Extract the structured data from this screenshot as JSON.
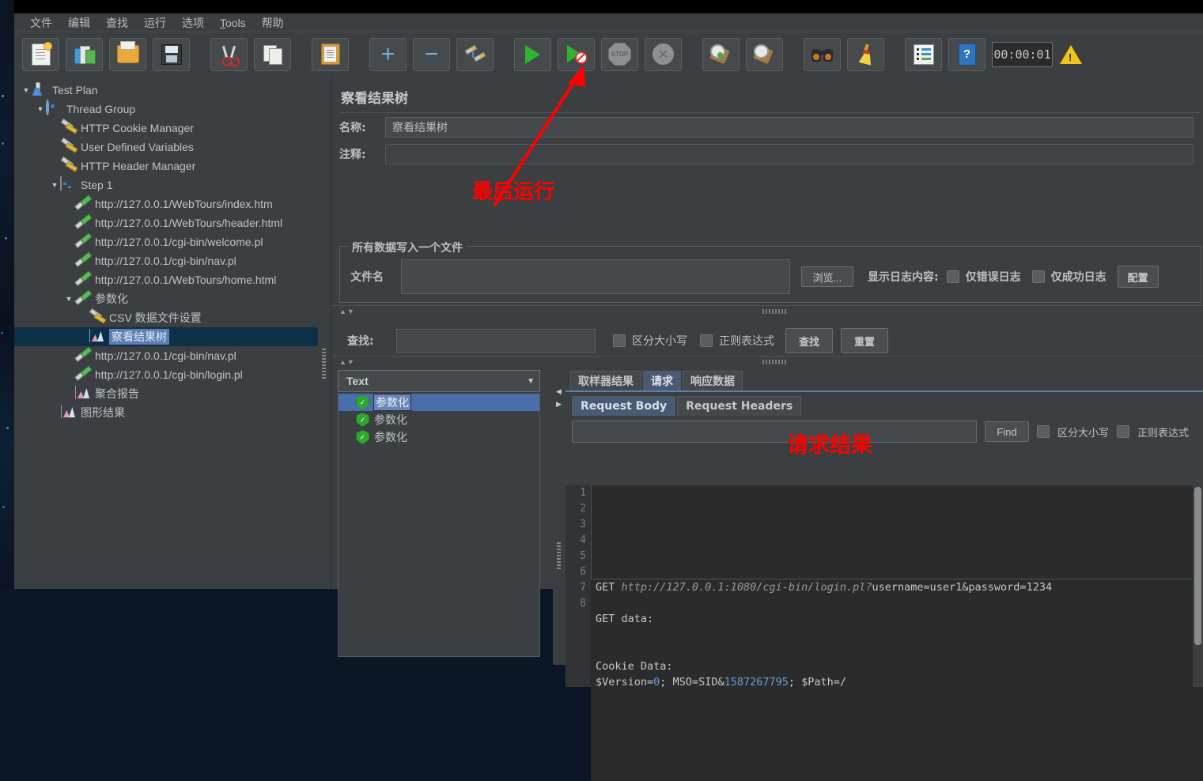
{
  "menu": {
    "items": [
      {
        "label": "文件",
        "mnemonic": ""
      },
      {
        "label": "编辑",
        "mnemonic": ""
      },
      {
        "label": "查找",
        "mnemonic": ""
      },
      {
        "label": "运行",
        "mnemonic": ""
      },
      {
        "label": "选项",
        "mnemonic": ""
      },
      {
        "label": "Tools",
        "mnemonic": "T"
      },
      {
        "label": "帮助",
        "mnemonic": ""
      }
    ]
  },
  "toolbar": {
    "buttons": [
      {
        "name": "new-icon",
        "title": "新建"
      },
      {
        "name": "templates-icon",
        "title": "模板"
      },
      {
        "name": "open-icon",
        "title": "打开"
      },
      {
        "name": "save-icon",
        "title": "保存"
      },
      {
        "name": "cut-icon",
        "title": "剪切"
      },
      {
        "name": "copy-icon",
        "title": "复制"
      },
      {
        "name": "paste-icon",
        "title": "粘贴"
      },
      {
        "name": "expand-all-icon",
        "title": "展开"
      },
      {
        "name": "collapse-all-icon",
        "title": "折叠"
      },
      {
        "name": "toggle-icon",
        "title": "启用/禁用"
      },
      {
        "name": "start-icon",
        "title": "启动"
      },
      {
        "name": "start-no-pause-icon",
        "title": "无间隔启动"
      },
      {
        "name": "stop-icon",
        "title": "停止"
      },
      {
        "name": "shutdown-icon",
        "title": "关闭"
      },
      {
        "name": "clear-icon",
        "title": "清除"
      },
      {
        "name": "clear-all-icon",
        "title": "清除全部"
      },
      {
        "name": "search-icon",
        "title": "查找"
      },
      {
        "name": "search-reset-icon",
        "title": "重置查找"
      },
      {
        "name": "function-helper-icon",
        "title": "函数助手"
      },
      {
        "name": "help-icon",
        "title": "帮助"
      }
    ],
    "timer": "00:00:01",
    "warning_icon": "warning-triangle-icon"
  },
  "tree": {
    "nodes": [
      {
        "label": "Test Plan",
        "icon": "test-plan-icon",
        "indent": 0,
        "toggle": "▼",
        "selected": false
      },
      {
        "label": "Thread Group",
        "icon": "thread-group-icon",
        "indent": 1,
        "toggle": "▼",
        "selected": false
      },
      {
        "label": "HTTP Cookie Manager",
        "icon": "config-element-icon",
        "indent": 2,
        "toggle": "",
        "selected": false
      },
      {
        "label": "User Defined Variables",
        "icon": "config-element-icon",
        "indent": 2,
        "toggle": "",
        "selected": false
      },
      {
        "label": "HTTP Header Manager",
        "icon": "config-element-icon",
        "indent": 2,
        "toggle": "",
        "selected": false
      },
      {
        "label": "Step 1",
        "icon": "logic-controller-icon",
        "indent": 2,
        "toggle": "▼",
        "selected": false
      },
      {
        "label": "http://127.0.0.1/WebTours/index.htm",
        "icon": "http-sampler-icon",
        "indent": 3,
        "toggle": "",
        "selected": false
      },
      {
        "label": "http://127.0.0.1/WebTours/header.html",
        "icon": "http-sampler-icon",
        "indent": 3,
        "toggle": "",
        "selected": false
      },
      {
        "label": "http://127.0.0.1/cgi-bin/welcome.pl",
        "icon": "http-sampler-icon",
        "indent": 3,
        "toggle": "",
        "selected": false
      },
      {
        "label": "http://127.0.0.1/cgi-bin/nav.pl",
        "icon": "http-sampler-icon",
        "indent": 3,
        "toggle": "",
        "selected": false
      },
      {
        "label": "http://127.0.0.1/WebTours/home.html",
        "icon": "http-sampler-icon",
        "indent": 3,
        "toggle": "",
        "selected": false
      },
      {
        "label": "参数化",
        "icon": "http-sampler-icon",
        "indent": 3,
        "toggle": "▼",
        "selected": false
      },
      {
        "label": "CSV 数据文件设置",
        "icon": "config-element-icon",
        "indent": 4,
        "toggle": "",
        "selected": false
      },
      {
        "label": "察看结果树",
        "icon": "listener-icon",
        "indent": 4,
        "toggle": "",
        "selected": true
      },
      {
        "label": "http://127.0.0.1/cgi-bin/nav.pl",
        "icon": "http-sampler-icon",
        "indent": 3,
        "toggle": "",
        "selected": false
      },
      {
        "label": "http://127.0.0.1/cgi-bin/login.pl",
        "icon": "http-sampler-icon",
        "indent": 3,
        "toggle": "",
        "selected": false
      },
      {
        "label": "聚合报告",
        "icon": "listener-icon",
        "indent": 3,
        "toggle": "",
        "selected": false
      },
      {
        "label": "图形结果",
        "icon": "listener-icon",
        "indent": 2,
        "toggle": "",
        "selected": false
      }
    ]
  },
  "detail": {
    "title": "察看结果树",
    "name_label": "名称:",
    "name_value": "察看结果树",
    "comment_label": "注释:",
    "comment_value": "",
    "group_legend": "所有数据写入一个文件",
    "filename_label": "文件名",
    "filename_value": "",
    "browse_button": "浏览...",
    "log_display_label": "显示日志内容:",
    "errors_only": "仅错误日志",
    "success_only": "仅成功日志",
    "configure_button": "配置"
  },
  "search": {
    "label": "查找:",
    "value": "",
    "case_sensitive": "区分大小写",
    "regex": "正则表达式",
    "find_button": "查找",
    "reset_button": "重置"
  },
  "results": {
    "render_selector": "Text",
    "entries": [
      {
        "label": "参数化",
        "status": "success",
        "selected": true
      },
      {
        "label": "参数化",
        "status": "success",
        "selected": false
      },
      {
        "label": "参数化",
        "status": "success",
        "selected": false
      }
    ],
    "tabs": [
      {
        "label": "取样器结果",
        "active": false
      },
      {
        "label": "请求",
        "active": true
      },
      {
        "label": "响应数据",
        "active": false
      }
    ],
    "subtabs": [
      {
        "label": "Request Body",
        "active": true
      },
      {
        "label": "Request Headers",
        "active": false
      }
    ],
    "find": {
      "value": "",
      "button": "Find",
      "case_sensitive": "区分大小写",
      "regex": "正则表达式"
    },
    "code_lines": [
      {
        "n": "1",
        "text": "GET http://127.0.0.1:1080/cgi-bin/login.pl?username=user1&password=1234"
      },
      {
        "n": "2",
        "text": ""
      },
      {
        "n": "3",
        "text": "GET data:"
      },
      {
        "n": "4",
        "text": ""
      },
      {
        "n": "5",
        "text": ""
      },
      {
        "n": "6",
        "text": "Cookie Data:"
      },
      {
        "n": "7",
        "text": "$Version=0; MSO=SID&1587267795; $Path=/"
      },
      {
        "n": "8",
        "text": ""
      }
    ]
  },
  "annotations": [
    {
      "text": "最后运行",
      "color": "#ff0000"
    },
    {
      "text": "请求结果",
      "color": "#ff0000"
    }
  ],
  "colors": {
    "background": "#3c3f41",
    "panel": "#45494b",
    "selection": "#4a6ea9",
    "tree_selection": "#0d3049",
    "accent": "#5a7fb5",
    "annotation": "#ff0000",
    "code_background": "#2b2b2b"
  }
}
